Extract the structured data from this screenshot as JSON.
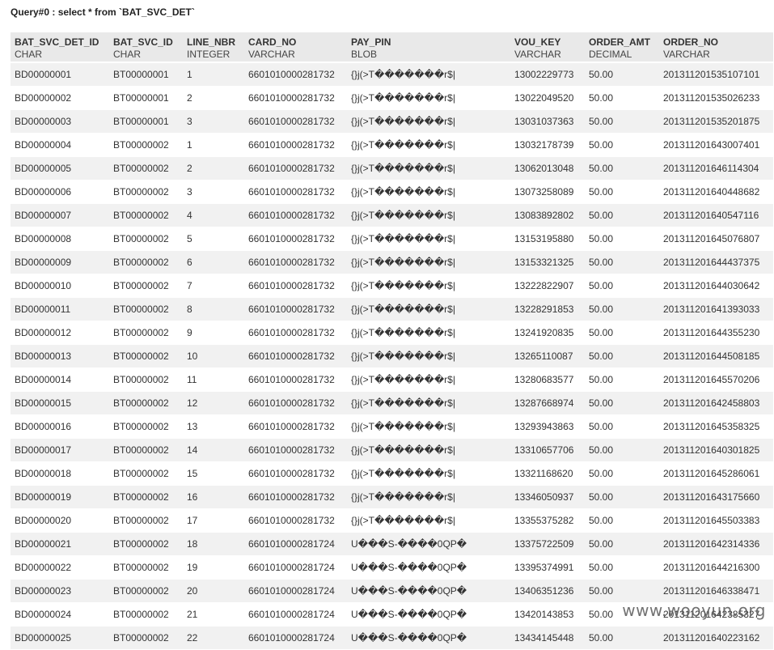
{
  "query_title": "Query#0 : select * from `BAT_SVC_DET`",
  "columns": [
    {
      "name": "BAT_SVC_DET_ID",
      "type": "CHAR"
    },
    {
      "name": "BAT_SVC_ID",
      "type": "CHAR"
    },
    {
      "name": "LINE_NBR",
      "type": "INTEGER"
    },
    {
      "name": "CARD_NO",
      "type": "VARCHAR"
    },
    {
      "name": "PAY_PIN",
      "type": "BLOB"
    },
    {
      "name": "VOU_KEY",
      "type": "VARCHAR"
    },
    {
      "name": "ORDER_AMT",
      "type": "DECIMAL"
    },
    {
      "name": "ORDER_NO",
      "type": "VARCHAR"
    }
  ],
  "rows": [
    [
      "BD00000001",
      "BT00000001",
      "1",
      "6601010000281732",
      "{}j(>T�������r$|",
      "13002229773",
      "50.00",
      "201311201535107101"
    ],
    [
      "BD00000002",
      "BT00000001",
      "2",
      "6601010000281732",
      "{}j(>T�������r$|",
      "13022049520",
      "50.00",
      "201311201535026233"
    ],
    [
      "BD00000003",
      "BT00000001",
      "3",
      "6601010000281732",
      "{}j(>T�������r$|",
      "13031037363",
      "50.00",
      "201311201535201875"
    ],
    [
      "BD00000004",
      "BT00000002",
      "1",
      "6601010000281732",
      "{}j(>T�������r$|",
      "13032178739",
      "50.00",
      "201311201643007401"
    ],
    [
      "BD00000005",
      "BT00000002",
      "2",
      "6601010000281732",
      "{}j(>T�������r$|",
      "13062013048",
      "50.00",
      "201311201646114304"
    ],
    [
      "BD00000006",
      "BT00000002",
      "3",
      "6601010000281732",
      "{}j(>T�������r$|",
      "13073258089",
      "50.00",
      "201311201640448682"
    ],
    [
      "BD00000007",
      "BT00000002",
      "4",
      "6601010000281732",
      "{}j(>T�������r$|",
      "13083892802",
      "50.00",
      "201311201640547116"
    ],
    [
      "BD00000008",
      "BT00000002",
      "5",
      "6601010000281732",
      "{}j(>T�������r$|",
      "13153195880",
      "50.00",
      "201311201645076807"
    ],
    [
      "BD00000009",
      "BT00000002",
      "6",
      "6601010000281732",
      "{}j(>T�������r$|",
      "13153321325",
      "50.00",
      "201311201644437375"
    ],
    [
      "BD00000010",
      "BT00000002",
      "7",
      "6601010000281732",
      "{}j(>T�������r$|",
      "13222822907",
      "50.00",
      "201311201644030642"
    ],
    [
      "BD00000011",
      "BT00000002",
      "8",
      "6601010000281732",
      "{}j(>T�������r$|",
      "13228291853",
      "50.00",
      "201311201641393033"
    ],
    [
      "BD00000012",
      "BT00000002",
      "9",
      "6601010000281732",
      "{}j(>T�������r$|",
      "13241920835",
      "50.00",
      "201311201644355230"
    ],
    [
      "BD00000013",
      "BT00000002",
      "10",
      "6601010000281732",
      "{}j(>T�������r$|",
      "13265110087",
      "50.00",
      "201311201644508185"
    ],
    [
      "BD00000014",
      "BT00000002",
      "11",
      "6601010000281732",
      "{}j(>T�������r$|",
      "13280683577",
      "50.00",
      "201311201645570206"
    ],
    [
      "BD00000015",
      "BT00000002",
      "12",
      "6601010000281732",
      "{}j(>T�������r$|",
      "13287668974",
      "50.00",
      "201311201642458803"
    ],
    [
      "BD00000016",
      "BT00000002",
      "13",
      "6601010000281732",
      "{}j(>T�������r$|",
      "13293943863",
      "50.00",
      "201311201645358325"
    ],
    [
      "BD00000017",
      "BT00000002",
      "14",
      "6601010000281732",
      "{}j(>T�������r$|",
      "13310657706",
      "50.00",
      "201311201640301825"
    ],
    [
      "BD00000018",
      "BT00000002",
      "15",
      "6601010000281732",
      "{}j(>T�������r$|",
      "13321168620",
      "50.00",
      "201311201645286061"
    ],
    [
      "BD00000019",
      "BT00000002",
      "16",
      "6601010000281732",
      "{}j(>T�������r$|",
      "13346050937",
      "50.00",
      "201311201643175660"
    ],
    [
      "BD00000020",
      "BT00000002",
      "17",
      "6601010000281732",
      "{}j(>T�������r$|",
      "13355375282",
      "50.00",
      "201311201645503383"
    ],
    [
      "BD00000021",
      "BT00000002",
      "18",
      "6601010000281724",
      "U���S-����0QP�",
      "13375722509",
      "50.00",
      "201311201642314336"
    ],
    [
      "BD00000022",
      "BT00000002",
      "19",
      "6601010000281724",
      "U���S-����0QP�",
      "13395374991",
      "50.00",
      "201311201644216300"
    ],
    [
      "BD00000023",
      "BT00000002",
      "20",
      "6601010000281724",
      "U���S-����0QP�",
      "13406351236",
      "50.00",
      "201311201646338471"
    ],
    [
      "BD00000024",
      "BT00000002",
      "21",
      "6601010000281724",
      "U���S-����0QP�",
      "13420143853",
      "50.00",
      "201311201642385327"
    ],
    [
      "BD00000025",
      "BT00000002",
      "22",
      "6601010000281724",
      "U���S-����0QP�",
      "13434145448",
      "50.00",
      "201311201640223162"
    ]
  ],
  "watermark": "www.wooyun.org",
  "colors": {
    "header_bg": "#e9e9e9",
    "row_alt_bg": "#f1f1f1",
    "row_bg": "#ffffff",
    "text": "#333333"
  }
}
